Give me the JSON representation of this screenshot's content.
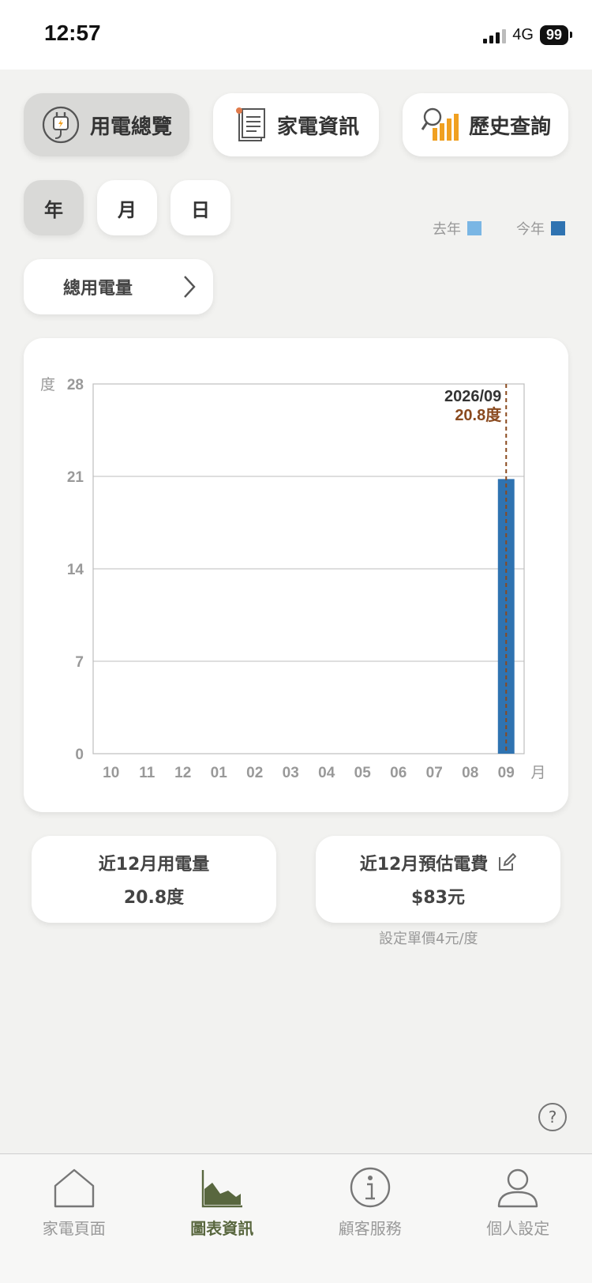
{
  "status": {
    "time": "12:57",
    "network": "4G",
    "battery": "99"
  },
  "tabs": [
    {
      "label": "用電總覽",
      "icon": "plug-icon",
      "active": true
    },
    {
      "label": "家電資訊",
      "icon": "document-icon",
      "active": false
    },
    {
      "label": "歷史查詢",
      "icon": "search-chart-icon",
      "active": false
    }
  ],
  "period": {
    "year": "年",
    "month": "月",
    "day": "日",
    "selected": "年"
  },
  "legend": {
    "last_year": "去年",
    "this_year": "今年",
    "last_year_color": "#7ab6e4",
    "this_year_color": "#2f73b1"
  },
  "selector": {
    "label": "總用電量"
  },
  "chart_data": {
    "type": "bar",
    "y_unit": "度",
    "x_unit": "月",
    "categories": [
      "10",
      "11",
      "12",
      "01",
      "02",
      "03",
      "04",
      "05",
      "06",
      "07",
      "08",
      "09"
    ],
    "series": [
      {
        "values": [
          0,
          0,
          0,
          0,
          0,
          0,
          0,
          0,
          0,
          0,
          0,
          20.8
        ],
        "color": "#2f73b1"
      }
    ],
    "ylim": [
      0,
      28
    ],
    "yticks": [
      "0",
      "7",
      "14",
      "21",
      "28"
    ],
    "tooltip": {
      "date": "2026/09",
      "value": "20.8度",
      "index": 11
    }
  },
  "stats": {
    "usage_title": "近12月用電量",
    "usage_value": "20.8度",
    "cost_title": "近12月預估電費",
    "cost_value": "$83元",
    "unit_price_note": "設定單價4元/度"
  },
  "nav": [
    {
      "label": "家電頁面",
      "icon": "home-icon"
    },
    {
      "label": "圖表資訊",
      "icon": "chart-icon",
      "active": true
    },
    {
      "label": "顧客服務",
      "icon": "info-icon"
    },
    {
      "label": "個人設定",
      "icon": "user-icon"
    }
  ],
  "colors": {
    "accent_green": "#59673f",
    "tooltip_brown": "#8a4a1f"
  }
}
